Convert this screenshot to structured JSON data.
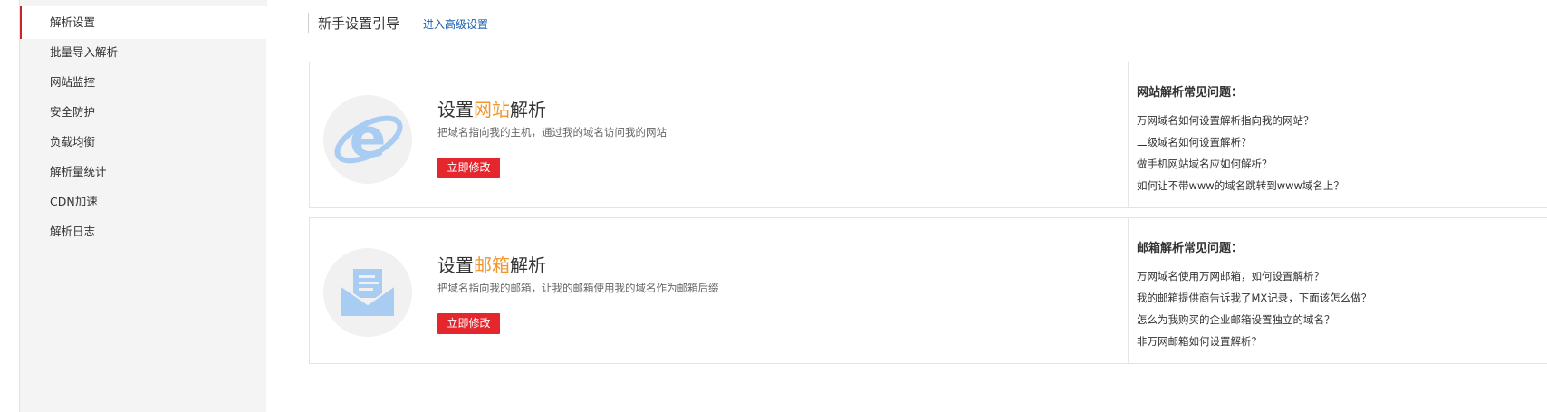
{
  "sidebar": {
    "items": [
      {
        "label": "解析设置",
        "active": true
      },
      {
        "label": "批量导入解析",
        "active": false
      },
      {
        "label": "网站监控",
        "active": false
      },
      {
        "label": "安全防护",
        "active": false
      },
      {
        "label": "负载均衡",
        "active": false
      },
      {
        "label": "解析量统计",
        "active": false
      },
      {
        "label": "CDN加速",
        "active": false
      },
      {
        "label": "解析日志",
        "active": false
      }
    ]
  },
  "header": {
    "title": "新手设置引导",
    "advanced_link": "进入高级设置"
  },
  "cards": [
    {
      "icon": "ie-browser-icon",
      "title_prefix": "设置",
      "title_highlight": "网站",
      "title_suffix": "解析",
      "description": "把域名指向我的主机，通过我的域名访问我的网站",
      "button_label": "立即修改",
      "faq_title": "网站解析常见问题：",
      "faq": [
        "万网域名如何设置解析指向我的网站？",
        "二级域名如何设置解析？",
        "做手机网站域名应如何解析？",
        "如何让不带www的域名跳转到www域名上？"
      ]
    },
    {
      "icon": "mail-envelope-icon",
      "title_prefix": "设置",
      "title_highlight": "邮箱",
      "title_suffix": "解析",
      "description": "把域名指向我的邮箱，让我的邮箱使用我的域名作为邮箱后缀",
      "button_label": "立即修改",
      "faq_title": "邮箱解析常见问题：",
      "faq": [
        "万网域名使用万网邮箱，如何设置解析？",
        "我的邮箱提供商告诉我了MX记录，下面该怎么做？",
        "怎么为我购买的企业邮箱设置独立的域名？",
        "非万网邮箱如何设置解析？"
      ]
    }
  ],
  "colors": {
    "accent_red": "#e5262d",
    "active_border": "#c9252b",
    "highlight_orange": "#f0962b",
    "link_blue": "#1a5fb0",
    "icon_blue": "#a9ccf2"
  }
}
